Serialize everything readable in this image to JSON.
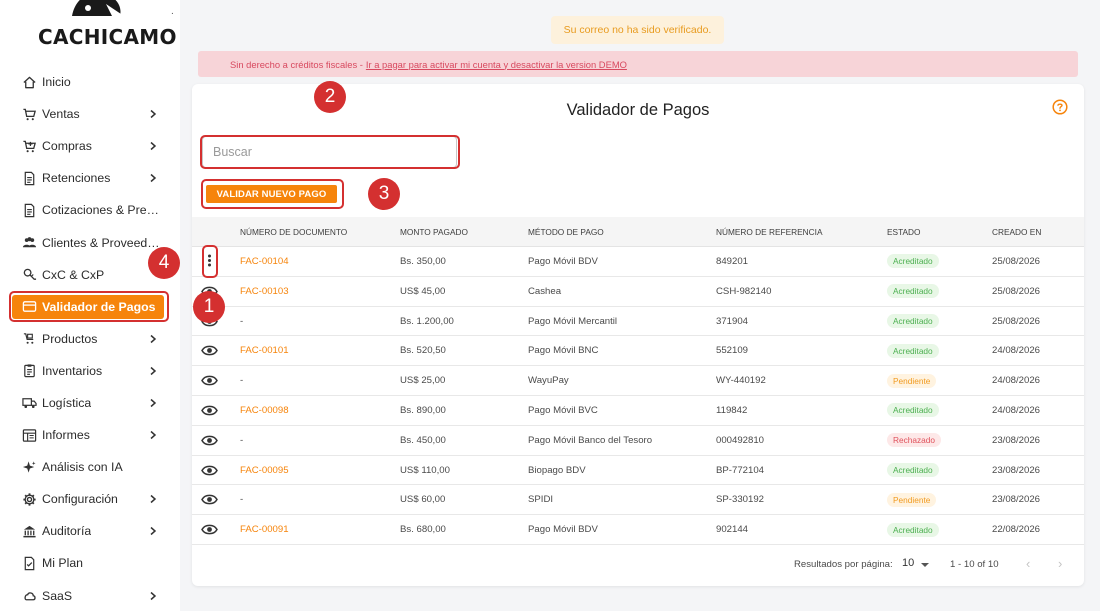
{
  "brand": {
    "name": "CACHICAMO"
  },
  "sidebar": {
    "items": [
      {
        "label": "Inicio",
        "icon": "home-icon",
        "chevron": false
      },
      {
        "label": "Ventas",
        "icon": "cart-icon",
        "chevron": true
      },
      {
        "label": "Compras",
        "icon": "cart-plus-icon",
        "chevron": true
      },
      {
        "label": "Retenciones",
        "icon": "document-icon",
        "chevron": true
      },
      {
        "label": "Cotizaciones & Presu...",
        "icon": "document-icon",
        "chevron": false
      },
      {
        "label": "Clientes & Proveedores",
        "icon": "people-icon",
        "chevron": false
      },
      {
        "label": "CxC & CxP",
        "icon": "accounts-icon",
        "chevron": false
      },
      {
        "label": "Validador de Pagos",
        "icon": "card-icon",
        "chevron": false,
        "active": true
      },
      {
        "label": "Productos",
        "icon": "products-icon",
        "chevron": true
      },
      {
        "label": "Inventarios",
        "icon": "clipboard-icon",
        "chevron": true
      },
      {
        "label": "Logística",
        "icon": "truck-icon",
        "chevron": true
      },
      {
        "label": "Informes",
        "icon": "report-icon",
        "chevron": true
      },
      {
        "label": "Análisis con IA",
        "icon": "sparkle-icon",
        "chevron": false
      },
      {
        "label": "Configuración",
        "icon": "gear-icon",
        "chevron": true
      },
      {
        "label": "Auditoría",
        "icon": "audit-icon",
        "chevron": true
      },
      {
        "label": "Mi Plan",
        "icon": "plan-icon",
        "chevron": false
      },
      {
        "label": "SaaS",
        "icon": "cloud-icon",
        "chevron": true
      }
    ]
  },
  "alerts": {
    "verify": "Su correo no ha sido verificado.",
    "fiscal_text": "Sin derecho a créditos fiscales -",
    "fiscal_link": "Ir a pagar para activar mi cuenta y desactivar la version DEMO"
  },
  "main": {
    "title": "Validador de Pagos",
    "search_placeholder": "Buscar",
    "new_button": "VALIDAR NUEVO PAGO",
    "columns": [
      "NÚMERO DE DOCUMENTO",
      "MONTO PAGADO",
      "MÉTODO DE PAGO",
      "NÚMERO DE REFERENCIA",
      "ESTADO",
      "CREADO EN"
    ],
    "rows": [
      {
        "doc": "FAC-00104",
        "monto": "Bs. 350,00",
        "metodo": "Pago Móvil BDV",
        "ref": "849201",
        "estado": "Acreditado",
        "fecha": "25/08/2026",
        "action": "more"
      },
      {
        "doc": "FAC-00103",
        "monto": "US$ 45,00",
        "metodo": "Cashea",
        "ref": "CSH-982140",
        "estado": "Acreditado",
        "fecha": "25/08/2026",
        "action": "eye"
      },
      {
        "doc": "-",
        "monto": "Bs. 1.200,00",
        "metodo": "Pago Móvil Mercantil",
        "ref": "371904",
        "estado": "Acreditado",
        "fecha": "25/08/2026",
        "action": "eye"
      },
      {
        "doc": "FAC-00101",
        "monto": "Bs. 520,50",
        "metodo": "Pago Móvil BNC",
        "ref": "552109",
        "estado": "Acreditado",
        "fecha": "24/08/2026",
        "action": "eye"
      },
      {
        "doc": "-",
        "monto": "US$ 25,00",
        "metodo": "WayuPay",
        "ref": "WY-440192",
        "estado": "Pendiente",
        "fecha": "24/08/2026",
        "action": "eye"
      },
      {
        "doc": "FAC-00098",
        "monto": "Bs. 890,00",
        "metodo": "Pago Móvil BVC",
        "ref": "119842",
        "estado": "Acreditado",
        "fecha": "24/08/2026",
        "action": "eye"
      },
      {
        "doc": "-",
        "monto": "Bs. 450,00",
        "metodo": "Pago Móvil Banco del Tesoro",
        "ref": "000492810",
        "estado": "Rechazado",
        "fecha": "23/08/2026",
        "action": "eye"
      },
      {
        "doc": "FAC-00095",
        "monto": "US$ 110,00",
        "metodo": "Biopago BDV",
        "ref": "BP-772104",
        "estado": "Acreditado",
        "fecha": "23/08/2026",
        "action": "eye"
      },
      {
        "doc": "-",
        "monto": "US$ 60,00",
        "metodo": "SPIDI",
        "ref": "SP-330192",
        "estado": "Pendiente",
        "fecha": "23/08/2026",
        "action": "eye"
      },
      {
        "doc": "FAC-00091",
        "monto": "Bs. 680,00",
        "metodo": "Pago Móvil BDV",
        "ref": "902144",
        "estado": "Acreditado",
        "fecha": "22/08/2026",
        "action": "eye"
      }
    ],
    "pagination": {
      "label": "Resultados por página:",
      "per_page": "10",
      "range": "1 - 10 of 10"
    }
  },
  "annotations": [
    "1",
    "2",
    "3",
    "4"
  ],
  "colors": {
    "accent": "#f6840b",
    "annotation": "#d43030"
  }
}
